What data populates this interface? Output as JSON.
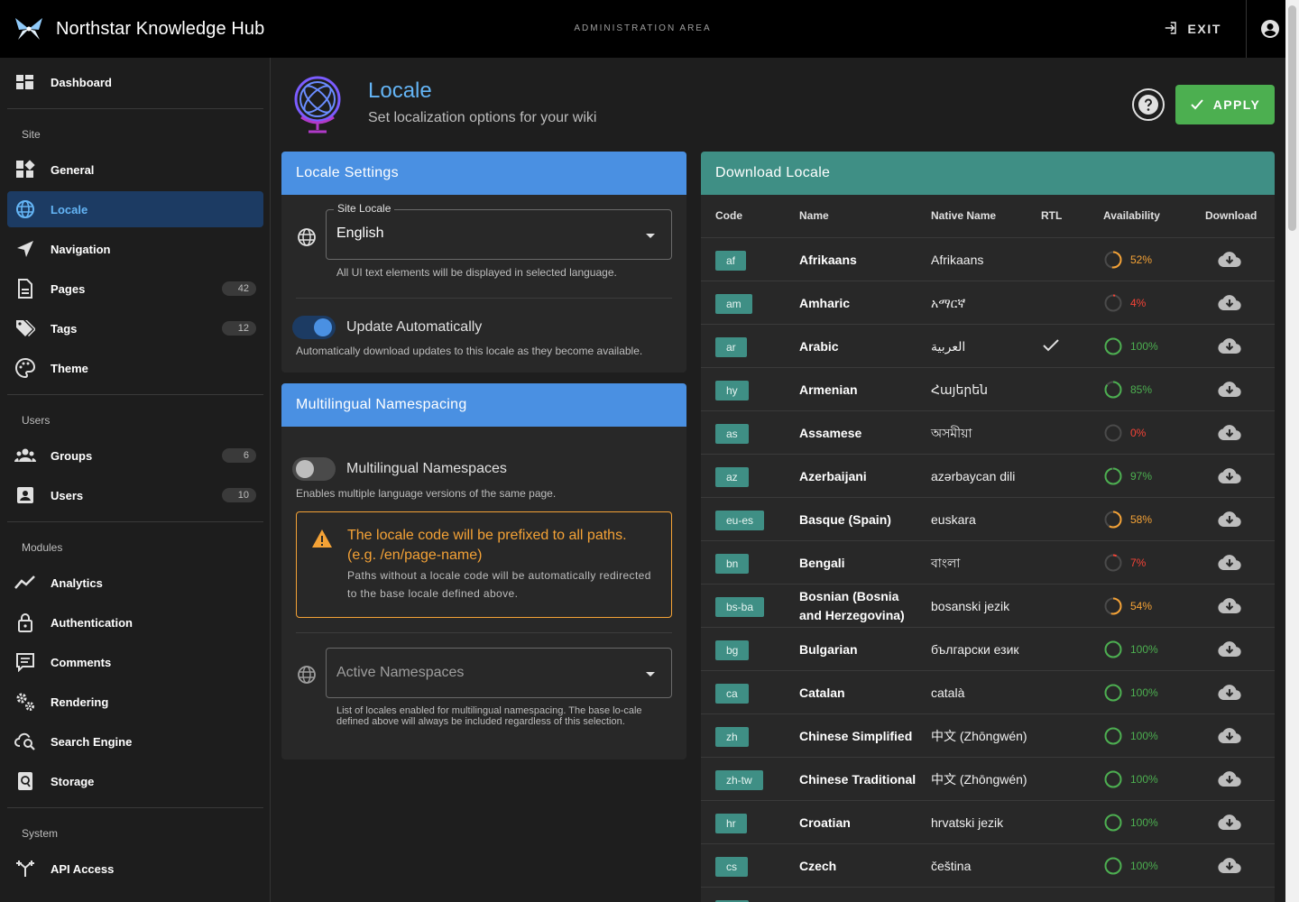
{
  "topbar": {
    "title": "Northstar Knowledge Hub",
    "admin_area": "ADMINISTRATION AREA",
    "exit_label": "EXIT"
  },
  "sidebar": {
    "items": {
      "dashboard": {
        "label": "Dashboard"
      },
      "general": {
        "label": "General"
      },
      "locale": {
        "label": "Locale"
      },
      "navigation": {
        "label": "Navigation"
      },
      "pages": {
        "label": "Pages",
        "count": "42"
      },
      "tags": {
        "label": "Tags",
        "count": "12"
      },
      "theme": {
        "label": "Theme"
      },
      "groups": {
        "label": "Groups",
        "count": "6"
      },
      "users": {
        "label": "Users",
        "count": "10"
      },
      "analytics": {
        "label": "Analytics"
      },
      "authentication": {
        "label": "Authentication"
      },
      "comments": {
        "label": "Comments"
      },
      "rendering": {
        "label": "Rendering"
      },
      "search": {
        "label": "Search Engine"
      },
      "storage": {
        "label": "Storage"
      },
      "api": {
        "label": "API Access"
      }
    },
    "sections": {
      "site": "Site",
      "users": "Users",
      "modules": "Modules",
      "system": "System"
    }
  },
  "header": {
    "title": "Locale",
    "subtitle": "Set localization options for your wiki",
    "apply_label": "APPLY"
  },
  "locale_settings": {
    "title": "Locale Settings",
    "site_locale_label": "Site Locale",
    "site_locale_value": "English",
    "site_locale_hint": "All UI text elements will be displayed in selected language.",
    "update_label": "Update Automatically",
    "update_hint": "Automatically download updates to this locale as they become available.",
    "update_enabled": true
  },
  "multilingual": {
    "title": "Multilingual Namespacing",
    "toggle_label": "Multilingual Namespaces",
    "toggle_hint": "Enables multiple language versions of the same page.",
    "enabled": false,
    "alert_title": "The locale code will be prefixed to all paths. (e.g. /en/page-name)",
    "alert_body": "Paths without a locale code will be automatically redirected to the base locale defined above.",
    "namespaces_placeholder": "Active Namespaces",
    "namespaces_hint": "List of locales enabled for multilingual namespacing. The base lo-cale defined above will always be included regardless of this selection."
  },
  "download": {
    "title": "Download Locale",
    "columns": {
      "code": "Code",
      "name": "Name",
      "native": "Native Name",
      "rtl": "RTL",
      "availability": "Availability",
      "download": "Download"
    },
    "rows": [
      {
        "code": "af",
        "name": "Afrikaans",
        "native": "Afrikaans",
        "rtl": false,
        "availability": 52
      },
      {
        "code": "am",
        "name": "Amharic",
        "native": "አማርኛ",
        "rtl": false,
        "availability": 4
      },
      {
        "code": "ar",
        "name": "Arabic",
        "native": "العربية",
        "rtl": true,
        "availability": 100
      },
      {
        "code": "hy",
        "name": "Armenian",
        "native": "Հայերեն",
        "rtl": false,
        "availability": 85
      },
      {
        "code": "as",
        "name": "Assamese",
        "native": "অসমীয়া",
        "rtl": false,
        "availability": 0
      },
      {
        "code": "az",
        "name": "Azerbaijani",
        "native": "azərbaycan dili",
        "rtl": false,
        "availability": 97
      },
      {
        "code": "eu-es",
        "name": "Basque (Spain)",
        "native": "euskara",
        "rtl": false,
        "availability": 58
      },
      {
        "code": "bn",
        "name": "Bengali",
        "native": "বাংলা",
        "rtl": false,
        "availability": 7
      },
      {
        "code": "bs-ba",
        "name": "Bosnian (Bosnia and Herzegovina)",
        "native": "bosanski jezik",
        "rtl": false,
        "availability": 54
      },
      {
        "code": "bg",
        "name": "Bulgarian",
        "native": "български език",
        "rtl": false,
        "availability": 100
      },
      {
        "code": "ca",
        "name": "Catalan",
        "native": "català",
        "rtl": false,
        "availability": 100
      },
      {
        "code": "zh",
        "name": "Chinese Simplified",
        "native": "中文 (Zhōngwén)",
        "rtl": false,
        "availability": 100
      },
      {
        "code": "zh-tw",
        "name": "Chinese Traditional",
        "native": "中文 (Zhōngwén)",
        "rtl": false,
        "availability": 100
      },
      {
        "code": "hr",
        "name": "Croatian",
        "native": "hrvatski jezik",
        "rtl": false,
        "availability": 100
      },
      {
        "code": "cs",
        "name": "Czech",
        "native": "čeština",
        "rtl": false,
        "availability": 100
      }
    ]
  },
  "colors": {
    "accent": "#4a90e2",
    "teal": "#3f8f85",
    "success": "#4caf50",
    "warning": "#f4a236",
    "danger": "#f44336",
    "active": "#64b5f6"
  }
}
